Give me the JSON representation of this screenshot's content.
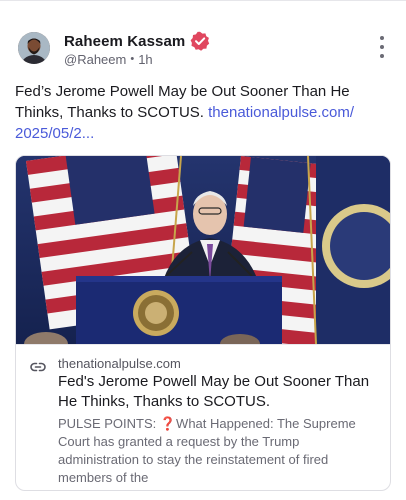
{
  "author": {
    "name": "Raheem Kassam",
    "handle": "@Raheem",
    "time": "1h",
    "separator": "•"
  },
  "post": {
    "text": "Fed’s Jerome Powell May be Out Sooner Than He Thinks, Thanks to SCOTUS. ",
    "link_text": "thenationalpulse.com/​2025/05/2..."
  },
  "card": {
    "domain": "thenationalpulse.com",
    "title": "Fed's Jerome Powell May be Out Sooner Than He Thinks, Thanks to SCOTUS.",
    "description": "PULSE POINTS: ❓What Happened: The Supreme Court has granted a request by the Trump administration to stay the reinstatement of fired members of the"
  },
  "colors": {
    "verified_badge": "#e0475f",
    "link": "#4a5ad9"
  },
  "icons": {
    "verified": "verified-badge-icon",
    "more": "more-options-icon",
    "link": "link-icon"
  }
}
